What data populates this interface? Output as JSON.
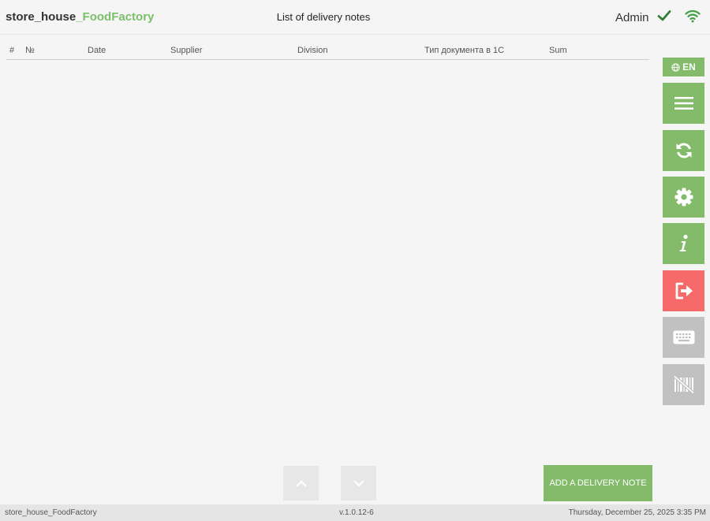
{
  "header": {
    "brand_prefix": "store_house",
    "brand_accent": "_FoodFactory",
    "title": "List of delivery notes",
    "user": "Admin",
    "status_icons": [
      "check-icon",
      "wifi-icon"
    ]
  },
  "table": {
    "columns": [
      "#",
      "№",
      "Date",
      "Supplier",
      "Division",
      "Тип документа в 1С",
      "Sum"
    ],
    "rows": []
  },
  "sidebar": {
    "language": "EN",
    "buttons": [
      {
        "name": "menu",
        "icon": "hamburger-icon",
        "color": "#83bb6b"
      },
      {
        "name": "sync",
        "icon": "sync-icon",
        "color": "#83bb6b"
      },
      {
        "name": "settings",
        "icon": "gear-icon",
        "color": "#83bb6b"
      },
      {
        "name": "info",
        "icon": "info-icon",
        "color": "#83bb6b"
      },
      {
        "name": "logout",
        "icon": "logout-icon",
        "color": "#f66a6a"
      },
      {
        "name": "keyboard",
        "icon": "keyboard-icon",
        "color": "#c1c1c1"
      },
      {
        "name": "barcode-off",
        "icon": "barcode-off-icon",
        "color": "#c1c1c1"
      }
    ]
  },
  "actions": {
    "add_label": "ADD A DELIVERY NOTE"
  },
  "footer": {
    "app_name": "store_house_FoodFactory",
    "version": "v.1.0.12-6",
    "datetime": "Thursday, December 25, 2025 3:35 PM"
  },
  "colors": {
    "accent": "#83bb6b",
    "danger": "#f66a6a",
    "disabled": "#c1c1c1"
  }
}
